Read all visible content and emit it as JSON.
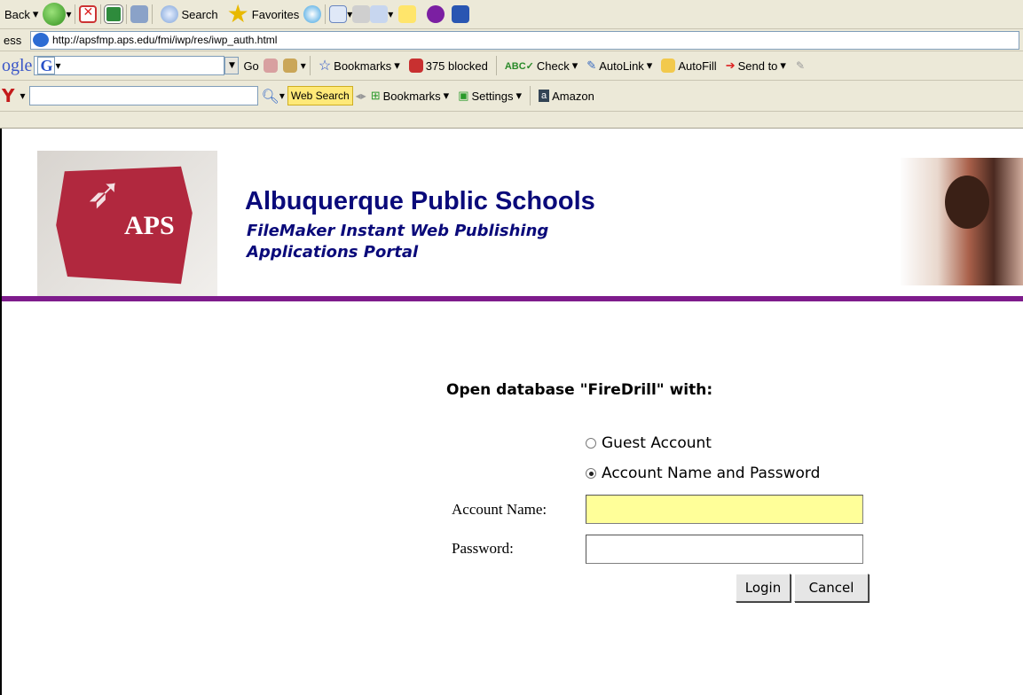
{
  "toolbar": {
    "back_label": "Back",
    "search_label": "Search",
    "favorites_label": "Favorites"
  },
  "address": {
    "label": "ess",
    "url": "http://apsfmp.aps.edu/fmi/iwp/res/iwp_auth.html"
  },
  "google_bar": {
    "logo": "ogle",
    "go_label": "Go",
    "bookmarks_label": "Bookmarks",
    "blocked_label": "375 blocked",
    "check_label": "Check",
    "autolink_label": "AutoLink",
    "autofill_label": "AutoFill",
    "sendto_label": "Send to"
  },
  "search_bar": {
    "web_search_label": "Web Search",
    "bookmarks_label": "Bookmarks",
    "settings_label": "Settings",
    "amazon_label": "Amazon"
  },
  "header": {
    "logo_text": "APS",
    "title": "Albuquerque Public Schools",
    "subtitle_line1": "FileMaker Instant Web Publishing",
    "subtitle_line2": "Applications Portal"
  },
  "login": {
    "heading": "Open database \"FireDrill\" with:",
    "guest_label": "Guest Account",
    "account_label": "Account Name and Password",
    "account_name_label": "Account Name:",
    "password_label": "Password:",
    "account_name_value": "",
    "password_value": "",
    "login_button": "Login",
    "cancel_button": "Cancel",
    "selected_option": "account"
  }
}
